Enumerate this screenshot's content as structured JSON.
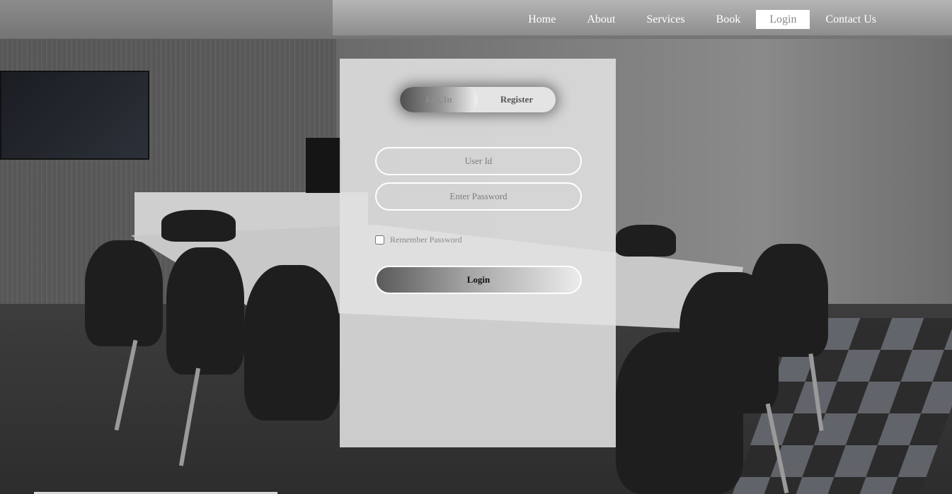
{
  "nav": {
    "items": [
      {
        "label": "Home",
        "active": false
      },
      {
        "label": "About",
        "active": false
      },
      {
        "label": "Services",
        "active": false
      },
      {
        "label": "Book",
        "active": false
      },
      {
        "label": "Login",
        "active": true
      },
      {
        "label": "Contact Us",
        "active": false
      }
    ]
  },
  "auth": {
    "tabs": {
      "login": "Log In",
      "register": "Register"
    },
    "user_placeholder": "User Id",
    "password_placeholder": "Enter Password",
    "remember_label": "Remember Password",
    "remember_checked": false,
    "submit_label": "Login"
  },
  "colors": {
    "card_bg": "#e1e1e1",
    "nav_active_bg": "#ffffff",
    "nav_text": "#ffffff"
  }
}
